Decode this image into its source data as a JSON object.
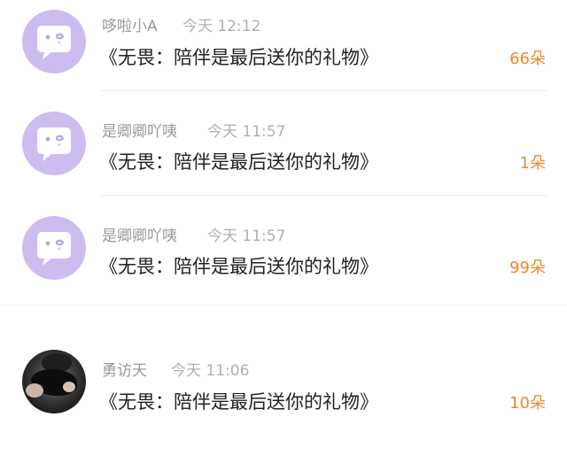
{
  "gifts": [
    {
      "user": "哆啦小A",
      "time": "今天 12:12",
      "message": "《无畏：陪伴是最后送你的礼物》",
      "count": "66朵",
      "avatar": "default-avatar-icon"
    },
    {
      "user": "是卿卿吖咦",
      "time": "今天 11:57",
      "message": "《无畏：陪伴是最后送你的礼物》",
      "count": "1朵",
      "avatar": "default-avatar-icon"
    },
    {
      "user": "是卿卿吖咦",
      "time": "今天 11:57",
      "message": "《无畏：陪伴是最后送你的礼物》",
      "count": "99朵",
      "avatar": "default-avatar-icon"
    },
    {
      "user": "勇访天",
      "time": "今天 11:06",
      "message": "《无畏：陪伴是最后送你的礼物》",
      "count": "10朵",
      "avatar": "user-photo"
    }
  ],
  "colors": {
    "avatar_bg": "#cdbcf0",
    "count": "#f0862b",
    "username": "#999999",
    "time": "#b0b0b0",
    "message": "#222222"
  }
}
